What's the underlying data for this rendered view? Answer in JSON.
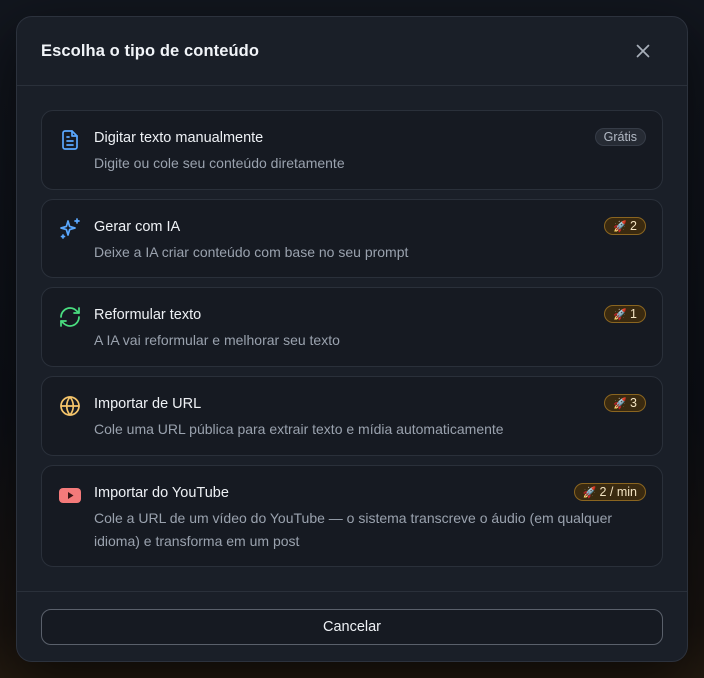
{
  "modal": {
    "title": "Escolha o tipo de conteúdo",
    "cancel_label": "Cancelar"
  },
  "options": [
    {
      "title": "Digitar texto manualmente",
      "description": "Digite ou cole seu conteúdo diretamente",
      "badge": "Grátis",
      "icon": "document-icon",
      "icon_color": "#5aa8ff"
    },
    {
      "title": "Gerar com IA",
      "description": "Deixe a IA criar conteúdo com base no seu prompt",
      "badge": "2",
      "icon": "sparkles-icon",
      "icon_color": "#5aa8ff"
    },
    {
      "title": "Reformular texto",
      "description": "A IA vai reformular e melhorar seu texto",
      "badge": "1",
      "icon": "refresh-icon",
      "icon_color": "#4ade80"
    },
    {
      "title": "Importar de URL",
      "description": "Cole uma URL pública para extrair texto e mídia automaticamente",
      "badge": "3",
      "icon": "globe-icon",
      "icon_color": "#f5c56b"
    },
    {
      "title": "Importar do YouTube",
      "description": "Cole a URL de um vídeo do YouTube — o sistema transcreve o áudio (em qualquer idioma) e transforma em um post",
      "badge": "2 / min",
      "icon": "youtube-icon",
      "icon_color": "#f47a7a"
    }
  ],
  "colors": {
    "accent_badge": "#e3b341",
    "background": "#1a1f28"
  }
}
